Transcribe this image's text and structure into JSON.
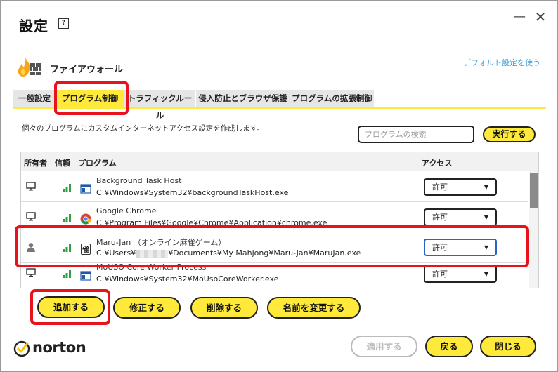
{
  "window": {
    "title": "設定",
    "help": "?",
    "minimize": "—",
    "close": "✕"
  },
  "section": {
    "label": "ファイアウォール",
    "default_link": "デフォルト設定を使う"
  },
  "tabs": [
    {
      "label": "一般設定"
    },
    {
      "label": "プログラム制御"
    },
    {
      "label": "トラフィックルール"
    },
    {
      "label": "侵入防止とブラウザ保護"
    },
    {
      "label": "プログラムの拡張制御"
    }
  ],
  "active_tab": 1,
  "description": "個々のプログラムにカスタムインターネットアクセス設定を作成します。",
  "search": {
    "placeholder": "プログラムの検索",
    "button": "実行する"
  },
  "table": {
    "headers": {
      "owner": "所有者",
      "trust": "信頼",
      "program": "プログラム",
      "access": "アクセス"
    },
    "rows": [
      {
        "owner_icon": "monitor-icon",
        "app_icon": "window-app-icon",
        "name": "Background Task Host",
        "path": "C:¥Windows¥System32¥backgroundTaskHost.exe",
        "access": "許可"
      },
      {
        "owner_icon": "monitor-icon",
        "app_icon": "chrome-icon",
        "name": "Google Chrome",
        "path": "C:¥Program Files¥Google¥Chrome¥Application¥chrome.exe",
        "access": "許可"
      },
      {
        "owner_icon": "user-icon",
        "app_icon": "mahjong-icon",
        "name": "Maru-Jan （オンライン麻雀ゲーム）",
        "path_prefix": "C:¥Users¥",
        "path_suffix": "¥Documents¥My Mahjong¥Maru-Jan¥MaruJan.exe",
        "access": "許可"
      },
      {
        "owner_icon": "monitor-icon",
        "app_icon": "window-app-icon",
        "name": "MoUSO Core Worker Process",
        "path": "C:¥Windows¥System32¥MoUsoCoreWorker.exe",
        "access": "許可"
      }
    ]
  },
  "actions": {
    "add": "追加する",
    "modify": "修正する",
    "delete": "削除する",
    "rename": "名前を変更する"
  },
  "footer": {
    "apply": "適用する",
    "back": "戻る",
    "close": "閉じる"
  },
  "brand": {
    "name": "norton"
  },
  "colors": {
    "accent_yellow": "#ffe93a",
    "highlight_red": "#e8121c",
    "link_blue": "#3f9fd6",
    "signal_green": "#2ea043"
  }
}
